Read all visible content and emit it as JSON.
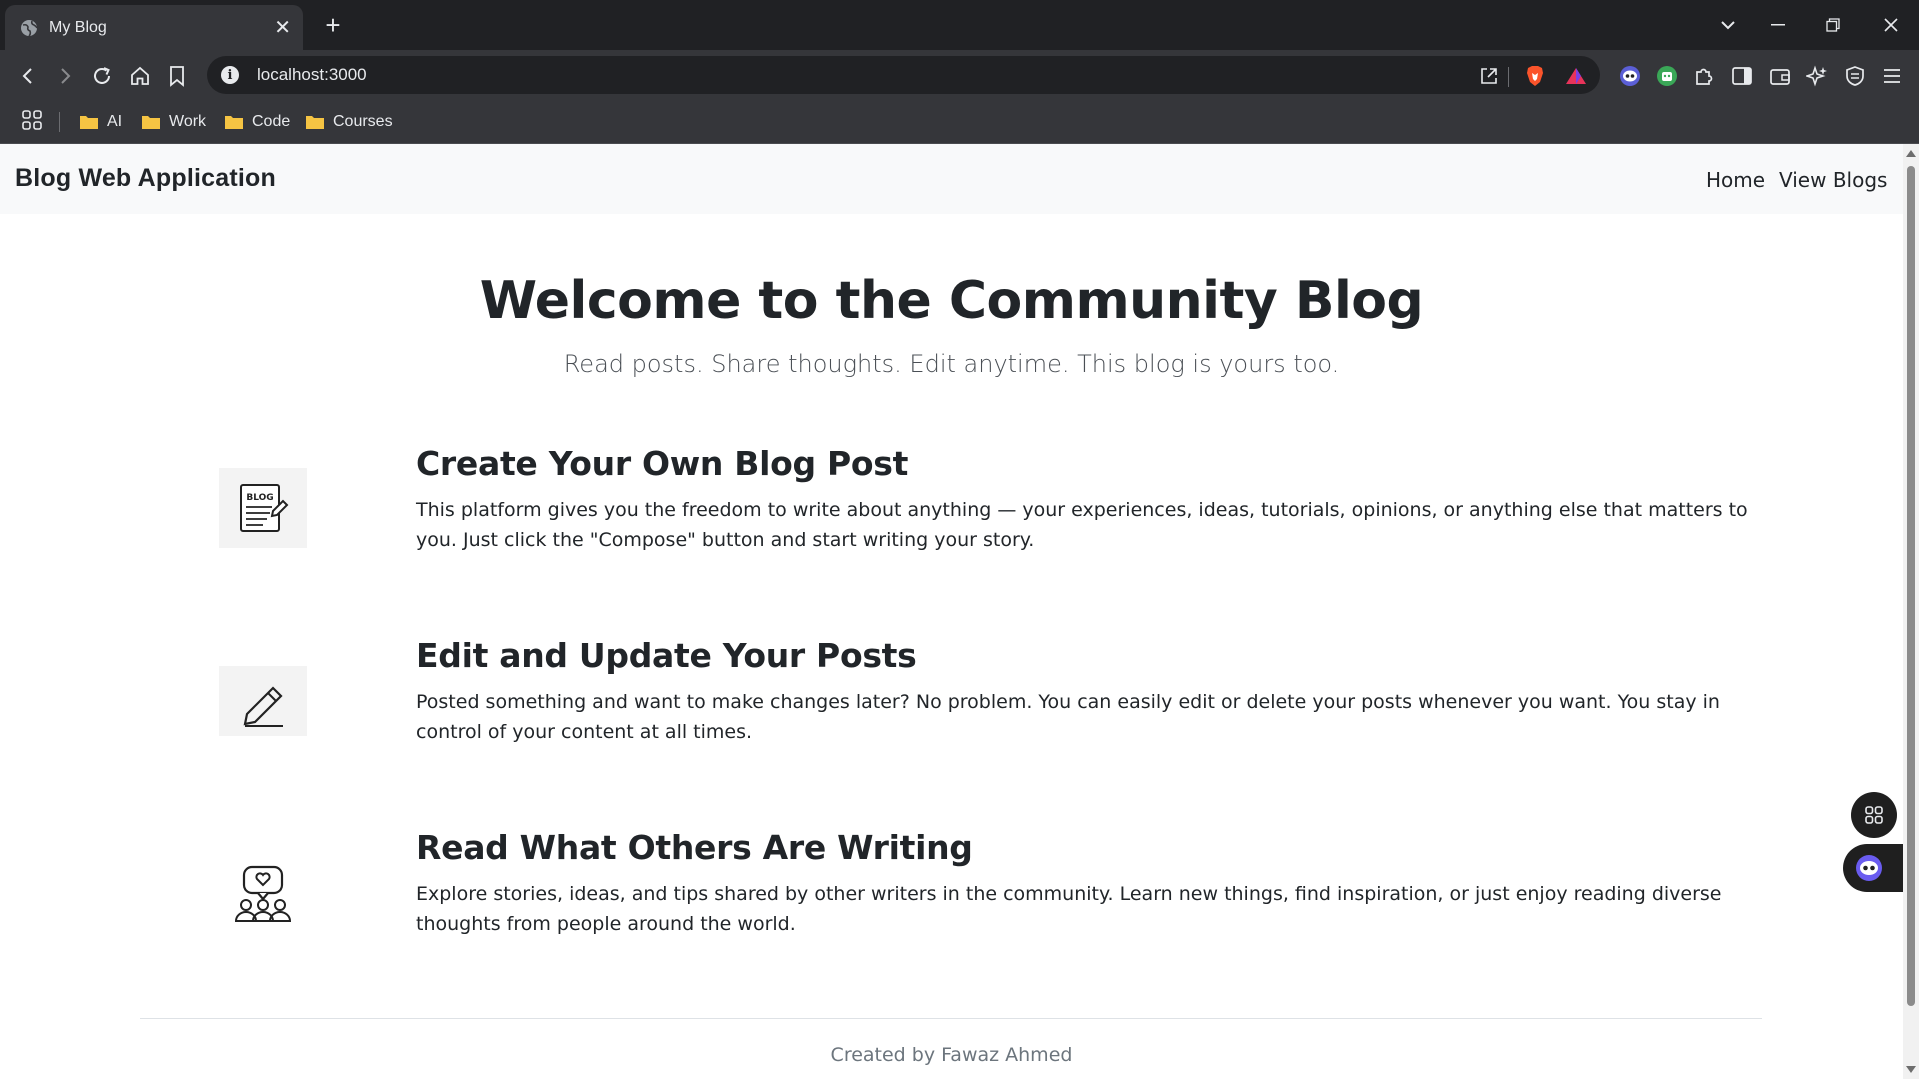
{
  "browser": {
    "tab_title": "My Blog",
    "tab_close": "✕",
    "new_tab": "+",
    "url": "localhost:3000",
    "bookmarks": [
      "AI",
      "Work",
      "Code",
      "Courses"
    ]
  },
  "site": {
    "brand": "Blog Web Application",
    "nav": [
      "Home",
      "View Blogs"
    ]
  },
  "hero": {
    "title": "Welcome to the Community Blog",
    "subtitle": "Read posts. Share thoughts. Edit anytime. This blog is yours too."
  },
  "features": [
    {
      "icon": "blog-document-icon",
      "icon_text": "BLOG",
      "title": "Create Your Own Blog Post",
      "text": "This platform gives you the freedom to write about anything — your experiences, ideas, tutorials, opinions, or anything else that matters to you. Just click the \"Compose\" button and start writing your story."
    },
    {
      "icon": "pencil-icon",
      "title": "Edit and Update Your Posts",
      "text": "Posted something and want to make changes later? No problem. You can easily edit or delete your posts whenever you want. You stay in control of your content at all times."
    },
    {
      "icon": "community-icon",
      "title": "Read What Others Are Writing",
      "text": "Explore stories, ideas, and tips shared by other writers in the community. Learn new things, find inspiration, or just enjoy reading diverse thoughts from people around the world."
    }
  ],
  "footer": {
    "text": "Created by Fawaz Ahmed"
  },
  "colors": {
    "chrome_dark": "#202124",
    "chrome_toolbar": "#35363a",
    "navbar_bg": "#f8f9fa",
    "text_dark": "#212529",
    "folder": "#f5c443"
  }
}
